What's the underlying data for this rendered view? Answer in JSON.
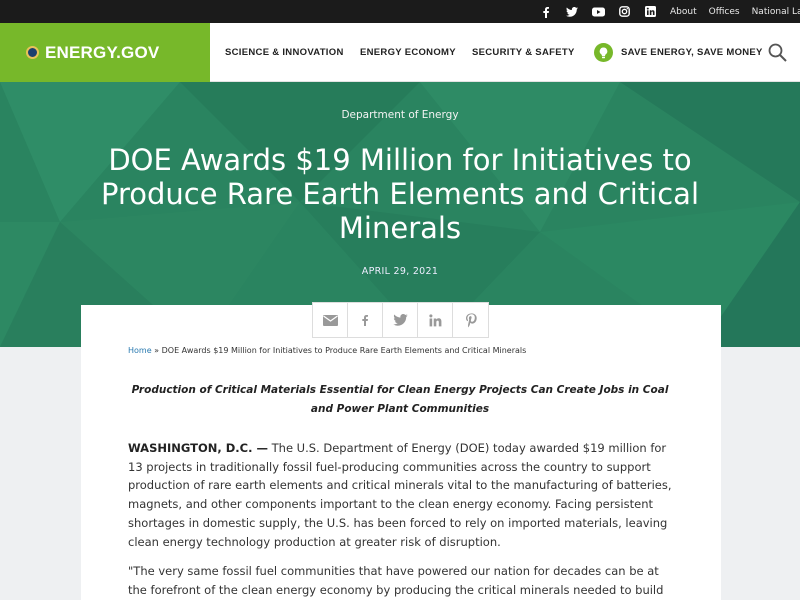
{
  "topbar": {
    "social": [
      {
        "name": "facebook-icon"
      },
      {
        "name": "twitter-icon"
      },
      {
        "name": "youtube-icon"
      },
      {
        "name": "instagram-icon"
      },
      {
        "name": "linkedin-icon"
      }
    ],
    "links": [
      "About",
      "Offices",
      "National Labs"
    ]
  },
  "nav": {
    "logo_text": "ENERGY.GOV",
    "items": [
      "SCIENCE & INNOVATION",
      "ENERGY ECONOMY",
      "SECURITY & SAFETY",
      "SAVE ENERGY, SAVE MONEY"
    ],
    "search_icon": "search-icon"
  },
  "hero": {
    "department": "Department of Energy",
    "title": "DOE Awards $19 Million for Initiatives to Produce Rare Earth Elements and Critical Minerals",
    "date": "APRIL 29, 2021"
  },
  "share": {
    "icons": [
      "email-icon",
      "facebook-icon",
      "twitter-icon",
      "linkedin-icon",
      "pinterest-icon"
    ]
  },
  "article": {
    "breadcrumb_home": "Home",
    "breadcrumb_sep": " » ",
    "breadcrumb_current": "DOE Awards $19 Million for Initiatives to Produce Rare Earth Elements and Critical Minerals",
    "subhead": "Production of Critical Materials Essential for Clean Energy Projects Can Create Jobs in Coal and Power Plant Communities",
    "dateline": "WASHINGTON, D.C. —",
    "paragraph1": " The U.S. Department of Energy (DOE) today awarded $19 million for 13 projects in traditionally fossil fuel-producing communities across the country to support production of rare earth elements and critical minerals vital to the manufacturing of batteries, magnets, and other components important to the clean energy economy. Facing persistent shortages in domestic supply, the U.S. has been forced to rely on imported materials, leaving clean energy technology production at greater risk of disruption.",
    "paragraph2": "\"The very same fossil fuel communities that have powered our nation for decades can be at the forefront of the clean energy economy by producing the critical minerals needed to build electric"
  },
  "colors": {
    "brand_green": "#77b82a",
    "hero_green": "#2a8460",
    "link_blue": "#2a7ab0"
  }
}
